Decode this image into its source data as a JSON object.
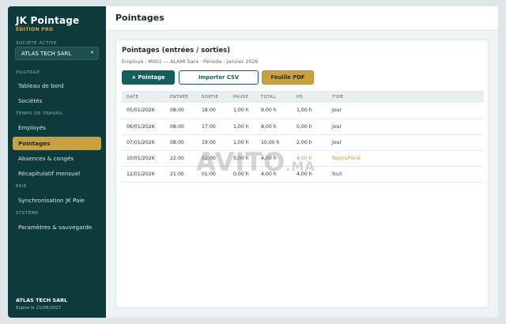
{
  "sidebar": {
    "brand_title": "JK Pointage",
    "brand_sub": "ÉDITION PRO",
    "company_label": "SOCIÉTÉ ACTIVE",
    "company_value": "ATLAS TECH SARL",
    "sections": {
      "pilotage": "PILOTAGE",
      "temps": "TEMPS DE TRAVAIL",
      "paie": "PAIE",
      "systeme": "SYSTÈME"
    },
    "items": {
      "tableau": "Tableau de bord",
      "societes": "Sociétés",
      "employes": "Employés",
      "pointages": "Pointages",
      "absences": "Absences & congés",
      "recap": "Récapitulatif mensuel",
      "sync": "Synchronisation JK Paie",
      "params": "Paramètres & sauvegarde"
    },
    "footer_title": "ATLAS TECH SARL",
    "footer_sub": "Expire le 21/06/2027"
  },
  "header": {
    "title": "Pointages"
  },
  "card": {
    "title": "Pointages (entrées / sorties)",
    "meta": "Employé : M001 — ALAMI Sara   ·   Période : Janvier 2026",
    "buttons": {
      "add": "+ Pointage",
      "import": "Importer CSV",
      "pdf": "Feuille PDF"
    },
    "columns": {
      "date": "DATE",
      "entree": "ENTRÉE",
      "sortie": "SORTIE",
      "pause": "PAUSE",
      "total": "TOTAL",
      "hs": "HS",
      "type": "TYPE"
    },
    "rows": [
      {
        "date": "05/01/2026",
        "entree": "08:00",
        "sortie": "18:00",
        "pause": "1,00 h",
        "total": "9,00 h",
        "hs": "1,00 h",
        "type": "Jour"
      },
      {
        "date": "06/01/2026",
        "entree": "08:00",
        "sortie": "17:00",
        "pause": "1,00 h",
        "total": "8,00 h",
        "hs": "0,00 h",
        "type": "Jour"
      },
      {
        "date": "07/01/2026",
        "entree": "08:00",
        "sortie": "19:00",
        "pause": "1,00 h",
        "total": "10,00 h",
        "hs": "2,00 h",
        "type": "Jour"
      },
      {
        "date": "10/01/2026",
        "entree": "22:00",
        "sortie": "02:00",
        "pause": "0,00 h",
        "total": "4,00 h",
        "hs": "4,00 h",
        "type": "Repos/Férié"
      },
      {
        "date": "12/01/2026",
        "entree": "21:00",
        "sortie": "01:00",
        "pause": "0,00 h",
        "total": "4,00 h",
        "hs": "4,00 h",
        "type": "Nuit"
      }
    ]
  },
  "watermark": {
    "main": "AVITO",
    "suffix": ".MA"
  },
  "colors": {
    "sidebar_bg": "#0d3b3b",
    "accent_gold": "#c9a23f",
    "primary_teal": "#155e5c"
  }
}
